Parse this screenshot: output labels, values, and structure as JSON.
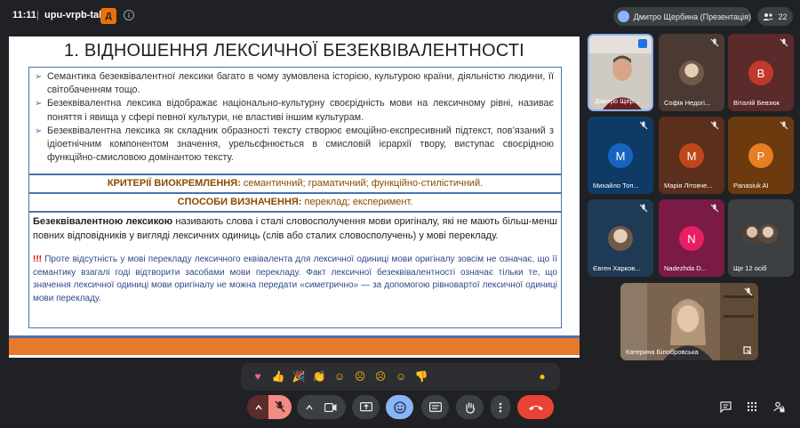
{
  "meet": {
    "time": "11:11",
    "separator": "|",
    "code": "upu-vrpb-tab",
    "present_badge": "Д"
  },
  "presenter_chip": {
    "label": "Дмитро Щербина (Презентація)"
  },
  "participants_count": "22",
  "slide": {
    "title": "1. ВІДНОШЕННЯ ЛЕКСИЧНОЇ БЕЗЕКВІВАЛЕНТНОСТІ",
    "bullets": [
      "Семантика безеквівалентної лексики багато в чому зумовлена історією, культурою країни, діяльністю людини, її світобаченням тощо.",
      "Безеквівалентна лексика відображає національно-культурну своєрідність мови на лексичному рівні, називає поняття і явища у сфері певної культури, не властиві іншим культурам.",
      "Безеквівалентна лексика як складник образності тексту створює емоційно-експресивний підтекст, пов’язаний з ідіоетнічним компонентом значення, урельєфнюється в смисловій ієрархії твору, виступає своєрідною функційно-смисловою домінантою тексту."
    ],
    "criteria_label": "КРИТЕРІЇ ВИОКРЕМЛЕННЯ:",
    "criteria_value": " семантичний; граматичний; функційно-стилістичний.",
    "methods_label": "СПОСОБИ ВИЗНАЧЕННЯ:",
    "methods_value": " переклад; експеримент.",
    "main_bold": "Безеквівалентною лексикою",
    "main_rest": " називають слова і сталі словосполучення мови оригіналу, які не мають більш-менш повних відповідників у вигляді лексичних одиниць (слів або сталих словосполучень) у мові перекладу.",
    "note_excl": "!!!",
    "note_text": " Проте відсутність у мові перекладу лексичного еквівалента для лексичної одиниці мови оригіналу зовсім не означає, що її семантику взагалі годі відтворити засобами мови перекладу. Факт лексичної безеквівалентності означає тільки те, що значення лексичної одиниці мови оригіналу не можна передати «симетрично» — за допомогою рівновартої лексичної одиниці мови перекладу."
  },
  "tiles": [
    {
      "name": "Дмитро Щер...",
      "type": "photo",
      "bg": "#c9c4bc"
    },
    {
      "name": "Софія Недогі...",
      "type": "photo",
      "bg": "#4a3a33"
    },
    {
      "name": "Віталій Бевзюк",
      "type": "letter",
      "letter": "B",
      "bg": "#5b2a2a",
      "avatar": "#c0392b"
    },
    {
      "name": "Михайло Топ...",
      "type": "letter",
      "letter": "M",
      "bg": "#0f3a66",
      "avatar": "#1565c0"
    },
    {
      "name": "Марія Літовче...",
      "type": "letter",
      "letter": "M",
      "bg": "#5c2e1c",
      "avatar": "#c0471b"
    },
    {
      "name": "Panasiuk AI",
      "type": "letter",
      "letter": "P",
      "bg": "#6b3a0e",
      "avatar": "#e67e22"
    },
    {
      "name": "Євген Харков...",
      "type": "photo",
      "bg": "#1e3a55"
    },
    {
      "name": "Nadezhda D...",
      "type": "letter",
      "letter": "N",
      "bg": "#7a1a45",
      "avatar": "#e91e63"
    },
    {
      "name": "Ще 12 осіб",
      "type": "group",
      "bg": "#3c4043"
    }
  ],
  "big_tile": {
    "name": "Катерина Білобровська"
  },
  "reactions": [
    "heart-emoji",
    "thumbs-up-emoji",
    "party-popper-emoji",
    "clapping-emoji",
    "laughing-emoji",
    "surprised-emoji",
    "sad-emoji",
    "thinking-emoji",
    "thumbs-down-emoji",
    "more-reactions"
  ],
  "colors": {
    "background": "#202124",
    "accent": "#8ab4f8",
    "hangup": "#ea4335",
    "slide_frame": "#4a72b0",
    "slide_stripe": "#e8782a"
  }
}
